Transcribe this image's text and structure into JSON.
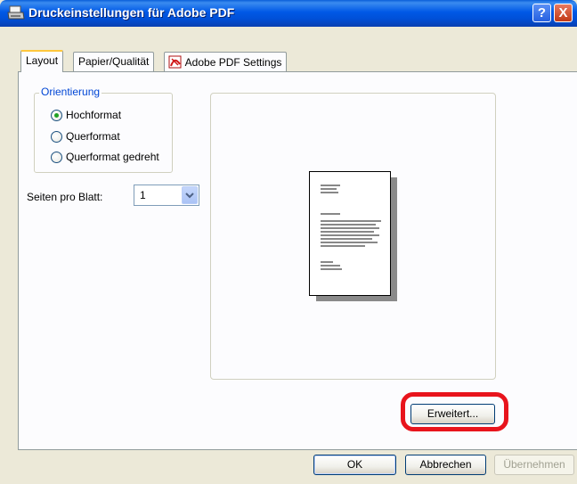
{
  "window": {
    "title": "Druckeinstellungen für Adobe PDF",
    "help_label": "?",
    "close_label": "X"
  },
  "tabs": [
    {
      "label": "Layout",
      "active": true
    },
    {
      "label": "Papier/Qualität",
      "active": false
    },
    {
      "label": "Adobe PDF Settings",
      "active": false,
      "icon": "adobe-pdf-icon"
    }
  ],
  "orientation": {
    "legend": "Orientierung",
    "options": [
      {
        "label": "Hochformat",
        "checked": true
      },
      {
        "label": "Querformat",
        "checked": false
      },
      {
        "label": "Querformat gedreht",
        "checked": false
      }
    ]
  },
  "pages_per_sheet": {
    "label": "Seiten pro Blatt:",
    "value": "1"
  },
  "buttons": {
    "advanced": "Erweitert...",
    "ok": "OK",
    "cancel": "Abbrechen",
    "apply": "Übernehmen"
  },
  "colors": {
    "title_bar": "#0058e6",
    "highlight": "#e8141c",
    "group_label": "#0046d5",
    "dialog_bg": "#ece9d8"
  }
}
